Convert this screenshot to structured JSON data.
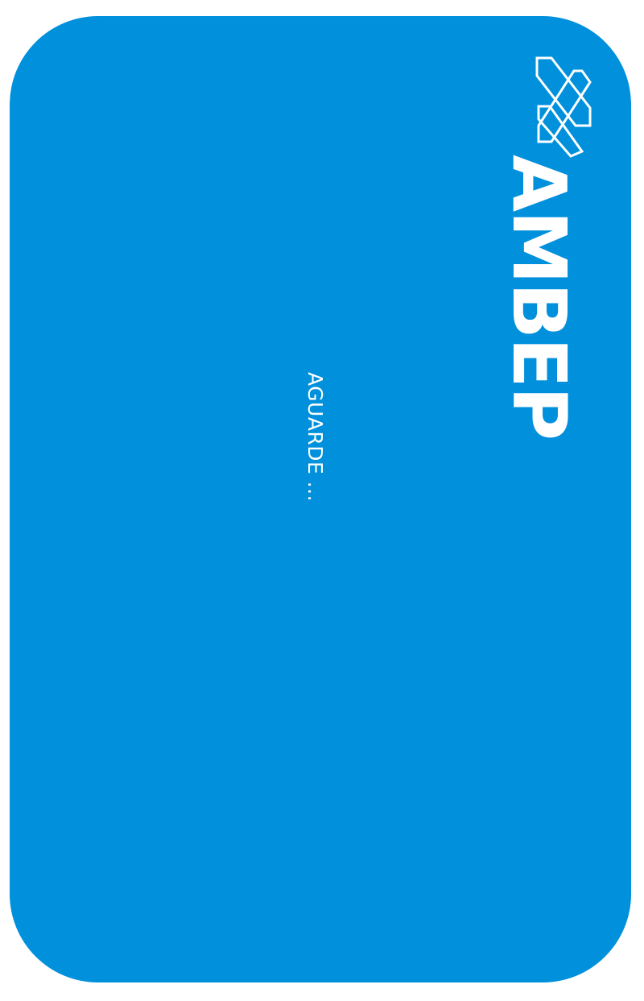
{
  "brand": {
    "name": "AMBEP",
    "logo_icon": "crossed-bands-icon",
    "background_color": "#0090dc",
    "text_color": "#ffffff"
  },
  "status": {
    "message": "AGUARDE ..."
  }
}
